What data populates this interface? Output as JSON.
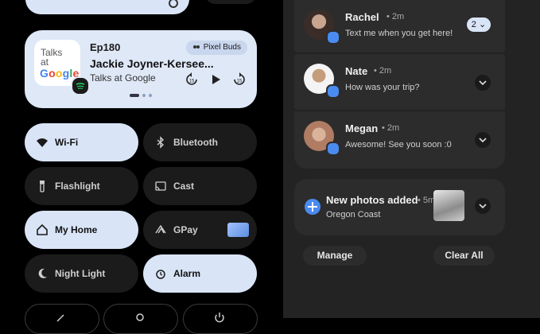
{
  "media": {
    "album_line1": "Talks",
    "album_line2": "at",
    "album_google": "Google",
    "episode": "Ep180",
    "title": "Jackie Joyner-Kersee...",
    "show": "Talks at Google",
    "device": "Pixel Buds",
    "rewind_label": "15",
    "forward_label": "15"
  },
  "tiles": [
    {
      "label": "Wi-Fi",
      "icon": "wifi-icon",
      "state": "on"
    },
    {
      "label": "Bluetooth",
      "icon": "bluetooth-icon",
      "state": "off"
    },
    {
      "label": "Flashlight",
      "icon": "flashlight-icon",
      "state": "off"
    },
    {
      "label": "Cast",
      "icon": "cast-icon",
      "state": "off"
    },
    {
      "label": "My Home",
      "icon": "home-icon",
      "state": "on"
    },
    {
      "label": "GPay",
      "icon": "gpay-icon",
      "state": "off"
    },
    {
      "label": "Night Light",
      "icon": "moon-icon",
      "state": "off"
    },
    {
      "label": "Alarm",
      "icon": "alarm-icon",
      "state": "on"
    }
  ],
  "notifications": [
    {
      "name": "Rachel",
      "time": "2m",
      "message": "Text me when you get here!",
      "count": "2"
    },
    {
      "name": "Nate",
      "time": "2m",
      "message": "How was your trip?"
    },
    {
      "name": "Megan",
      "time": "2m",
      "message": "Awesome! See you soon :0"
    }
  ],
  "photos": {
    "title": "New photos added",
    "time": "5m",
    "subtitle": "Oregon Coast"
  },
  "actions": {
    "manage": "Manage",
    "clear_all": "Clear All"
  },
  "colors": {
    "accent": "#d9e5f7",
    "badge": "#4a8bf0"
  }
}
